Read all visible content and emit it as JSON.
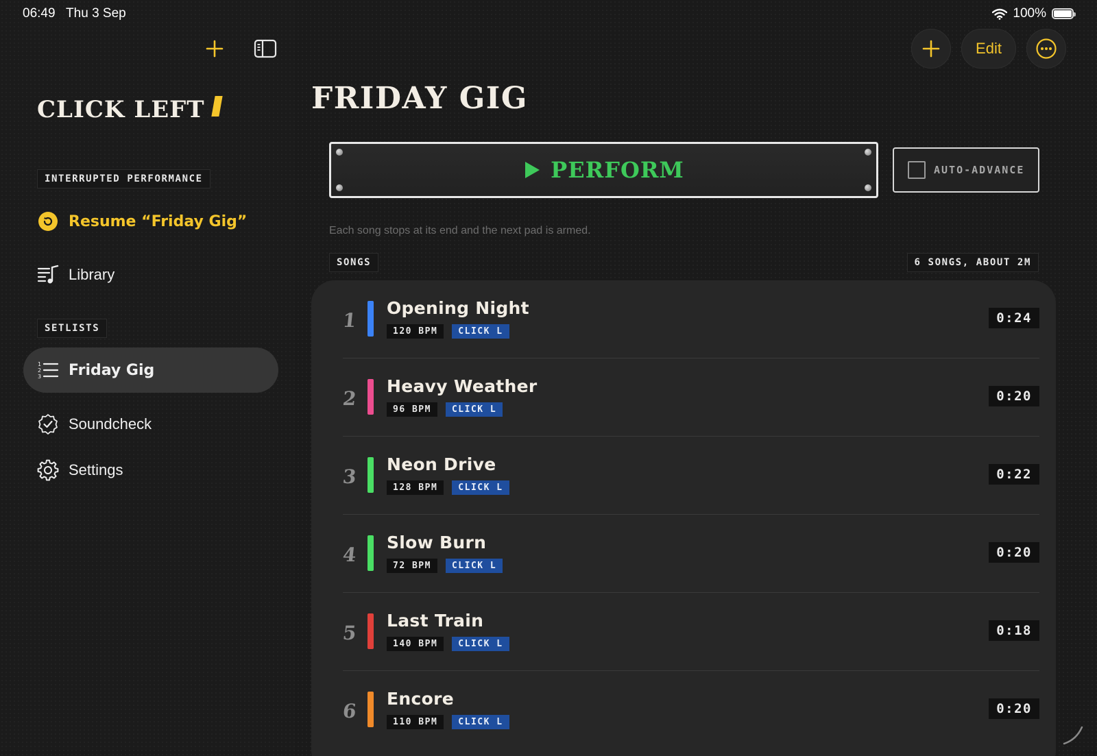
{
  "status_bar": {
    "time": "06:49",
    "date": "Thu 3 Sep",
    "battery": "100%"
  },
  "sidebar": {
    "brand": "CLICK LEFT",
    "interrupted_label": "INTERRUPTED PERFORMANCE",
    "resume_label": "Resume “Friday Gig”",
    "library_label": "Library",
    "setlists_label": "SETLISTS",
    "setlists": [
      {
        "label": "Friday Gig",
        "selected": true
      },
      {
        "label": "Soundcheck"
      }
    ],
    "settings_label": "Settings"
  },
  "toolbar": {
    "edit_label": "Edit"
  },
  "main": {
    "title": "FRIDAY GIG",
    "perform_label": "PERFORM",
    "auto_advance_label": "AUTO-ADVANCE",
    "auto_advance_checked": false,
    "hint": "Each song stops at its end and the next pad is armed.",
    "songs_label": "SONGS",
    "songs_summary": "6 SONGS, ABOUT 2M",
    "songs": [
      {
        "num": "1",
        "title": "Opening Night",
        "bpm": "120 BPM",
        "click": "CLICK L",
        "duration": "0:24",
        "color": "#3b82f6"
      },
      {
        "num": "2",
        "title": "Heavy Weather",
        "bpm": "96 BPM",
        "click": "CLICK L",
        "duration": "0:20",
        "color": "#ec4d8f"
      },
      {
        "num": "3",
        "title": "Neon Drive",
        "bpm": "128 BPM",
        "click": "CLICK L",
        "duration": "0:22",
        "color": "#4ade64"
      },
      {
        "num": "4",
        "title": "Slow Burn",
        "bpm": "72 BPM",
        "click": "CLICK L",
        "duration": "0:20",
        "color": "#4ade64"
      },
      {
        "num": "5",
        "title": "Last Train",
        "bpm": "140 BPM",
        "click": "CLICK L",
        "duration": "0:18",
        "color": "#e0403a"
      },
      {
        "num": "6",
        "title": "Encore",
        "bpm": "110 BPM",
        "click": "CLICK L",
        "duration": "0:20",
        "color": "#f08a2a"
      }
    ]
  },
  "colors": {
    "accent": "#f4c52b",
    "perform_green": "#3ec95a",
    "click_tag_blue": "#1f4e9e"
  }
}
